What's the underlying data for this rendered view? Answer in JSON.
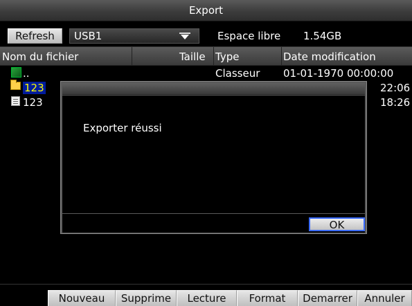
{
  "window": {
    "title": "Export"
  },
  "toolbar": {
    "refresh_label": "Refresh",
    "device": "USB1",
    "free_label": "Espace libre",
    "free_value": "1.54GB"
  },
  "list": {
    "headers": {
      "name": "Nom du fichier",
      "size": "Taille",
      "type": "Type",
      "date": "Date modification"
    },
    "rows": [
      {
        "name": "..",
        "size": "",
        "type": "Classeur",
        "date": "01-01-1970 00:00:00",
        "icon": "folder-up-icon",
        "selected": false
      },
      {
        "name": "123",
        "size": "",
        "type": "",
        "date": "22:06",
        "icon": "folder-icon",
        "selected": true
      },
      {
        "name": "123",
        "size": "",
        "type": "",
        "date": "18:26",
        "icon": "file-icon",
        "selected": false
      }
    ]
  },
  "footer": {
    "new_label": "Nouveau",
    "delete_label": "Supprime",
    "play_label": "Lecture",
    "format_label": "Format",
    "start_label": "Demarrer",
    "cancel_label": "Annuler"
  },
  "popup": {
    "message": "Exporter réussi",
    "ok_label": "OK"
  }
}
